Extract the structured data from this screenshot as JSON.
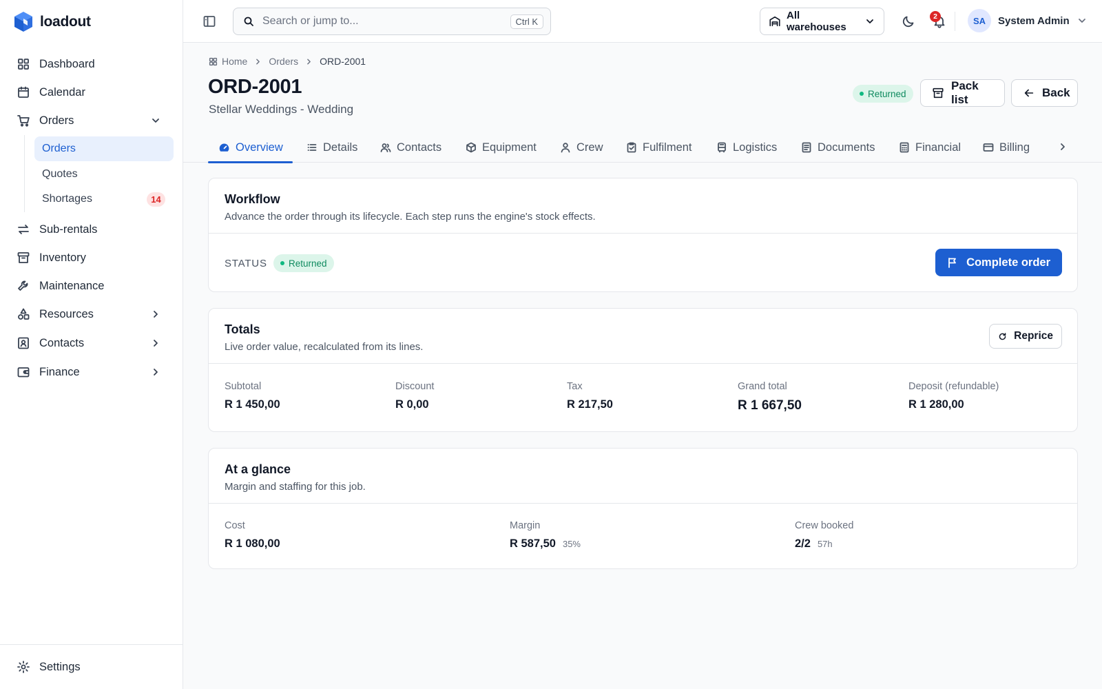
{
  "app": {
    "name": "loadout"
  },
  "sidebar": {
    "items": [
      {
        "label": "Dashboard",
        "icon": "dashboard-grid-icon"
      },
      {
        "label": "Calendar",
        "icon": "calendar-icon"
      },
      {
        "label": "Orders",
        "icon": "cart-icon",
        "expanded": true
      },
      {
        "label": "Sub-rentals",
        "icon": "arrows-swap-icon"
      },
      {
        "label": "Inventory",
        "icon": "archive-icon"
      },
      {
        "label": "Maintenance",
        "icon": "wrench-icon"
      },
      {
        "label": "Resources",
        "icon": "shapes-icon"
      },
      {
        "label": "Contacts",
        "icon": "contact-card-icon"
      },
      {
        "label": "Finance",
        "icon": "wallet-icon"
      }
    ],
    "orders_sub": [
      {
        "label": "Orders",
        "active": true
      },
      {
        "label": "Quotes"
      },
      {
        "label": "Shortages",
        "badge": "14"
      }
    ],
    "settings_label": "Settings"
  },
  "topbar": {
    "search_placeholder": "Search or jump to...",
    "search_shortcut": "Ctrl K",
    "warehouse": "All warehouses",
    "notifications_count": "2",
    "user_initials": "SA",
    "user_name": "System Admin"
  },
  "breadcrumb": [
    "Home",
    "Orders",
    "ORD-2001"
  ],
  "order": {
    "id": "ORD-2001",
    "subtitle": "Stellar Weddings - Wedding",
    "status": "Returned"
  },
  "header_actions": {
    "pack_list": "Pack list",
    "back": "Back"
  },
  "tabs": [
    {
      "label": "Overview",
      "icon": "gauge-icon",
      "active": true
    },
    {
      "label": "Details",
      "icon": "list-icon"
    },
    {
      "label": "Contacts",
      "icon": "users-icon"
    },
    {
      "label": "Equipment",
      "icon": "cube-icon"
    },
    {
      "label": "Crew",
      "icon": "person-icon"
    },
    {
      "label": "Fulfilment",
      "icon": "clipboard-check-icon"
    },
    {
      "label": "Logistics",
      "icon": "bus-icon"
    },
    {
      "label": "Documents",
      "icon": "document-icon"
    },
    {
      "label": "Financial",
      "icon": "calculator-icon"
    },
    {
      "label": "Billing",
      "icon": "credit-card-icon"
    }
  ],
  "workflow": {
    "title": "Workflow",
    "description": "Advance the order through its lifecycle. Each step runs the engine's stock effects.",
    "status_label": "STATUS",
    "status": "Returned",
    "action": "Complete order"
  },
  "totals": {
    "title": "Totals",
    "description": "Live order value, recalculated from its lines.",
    "action": "Reprice",
    "items": [
      {
        "label": "Subtotal",
        "value": "R 1 450,00"
      },
      {
        "label": "Discount",
        "value": "R 0,00"
      },
      {
        "label": "Tax",
        "value": "R 217,50"
      },
      {
        "label": "Grand total",
        "value": "R 1 667,50"
      },
      {
        "label": "Deposit (refundable)",
        "value": "R 1 280,00"
      }
    ]
  },
  "glance": {
    "title": "At a glance",
    "description": "Margin and staffing for this job.",
    "items": [
      {
        "label": "Cost",
        "value": "R 1 080,00",
        "meta": ""
      },
      {
        "label": "Margin",
        "value": "R 587,50",
        "meta": "35%"
      },
      {
        "label": "Crew booked",
        "value": "2/2",
        "meta": "57h"
      }
    ]
  },
  "colors": {
    "accent": "#1d5fd1",
    "status_green": "#0f8a5f",
    "danger": "#dc2626"
  }
}
